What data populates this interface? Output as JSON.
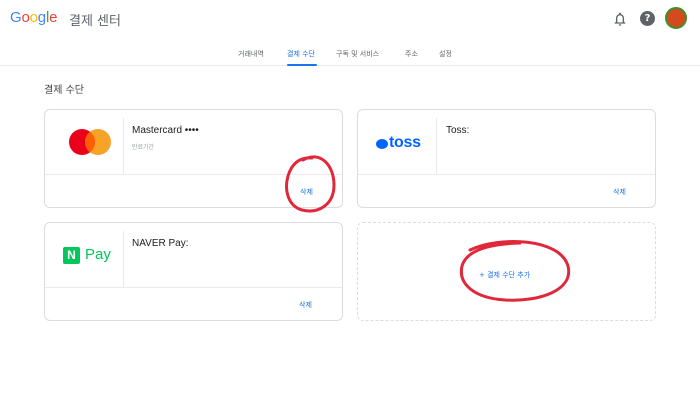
{
  "header": {
    "logo": [
      "G",
      "o",
      "o",
      "g",
      "l",
      "e"
    ],
    "product": "결제 센터"
  },
  "tabs": [
    "거래내역",
    "결제 수단",
    "구독 및 서비스",
    "주소",
    "설정"
  ],
  "active_tab": "결제 수단",
  "section_title": "결제 수단",
  "cards": {
    "mastercard": {
      "name": "Mastercard ••••",
      "sub": "만료기간",
      "delete": "삭제"
    },
    "toss": {
      "logo_text": "toss",
      "name": "Toss:",
      "delete": "삭제"
    },
    "naver": {
      "logo_n": "N",
      "logo_pay": "Pay",
      "name": "NAVER Pay:",
      "delete": "삭제"
    },
    "add": {
      "label": "+ 결제 수단 추가"
    }
  },
  "colors": {
    "accent": "#1a73e8",
    "annotation": "#e0283a",
    "toss_blue": "#0064ff",
    "naver_green": "#03c75a"
  },
  "icons": {
    "notifications": "bell-icon",
    "help": "help-icon"
  }
}
